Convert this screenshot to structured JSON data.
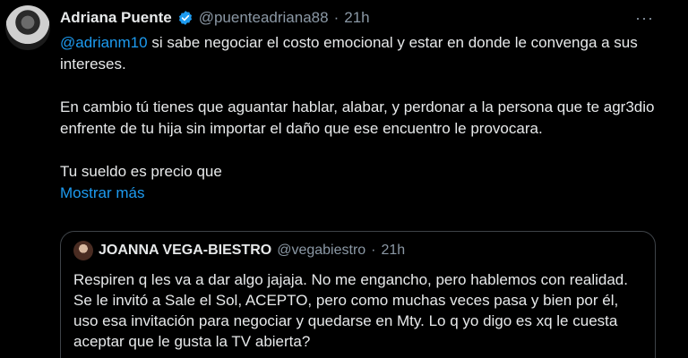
{
  "tweet": {
    "author": {
      "display_name": "Adriana Puente",
      "handle": "@puenteadriana88",
      "separator": "·",
      "time": "21h"
    },
    "more_label": "···",
    "mention": "@adrianm10",
    "line1_rest": " si sabe negociar el costo emocional y estar en donde le convenga a sus intereses.",
    "paragraph2": "En cambio tú tienes que aguantar hablar, alabar, y perdonar a la persona que te agr3dio enfrente de tu hija sin importar el daño que ese encuentro le provocara.",
    "paragraph3": "Tu sueldo es precio que",
    "show_more": "Mostrar más"
  },
  "quoted": {
    "display_name": "JOANNA VEGA-BIESTRO",
    "handle": "@vegabiestro",
    "separator": "·",
    "time": "21h",
    "text": "Respiren q les va a dar algo jajaja. No me engancho, pero hablemos con realidad. Se le invitó a Sale el Sol, ACEPTO, pero como muchas veces pasa y bien por él, uso esa invitación para negociar y quedarse en Mty. Lo q yo digo es xq le cuesta aceptar que le gusta la TV abierta?"
  },
  "colors": {
    "background": "#000000",
    "text": "#e7e9ea",
    "muted": "#8b98a5",
    "link": "#1d9bf0",
    "verified": "#1d9bf0",
    "border": "#3e4348"
  },
  "icons": {
    "verified": "verified-badge-icon",
    "more": "more-options-icon"
  }
}
